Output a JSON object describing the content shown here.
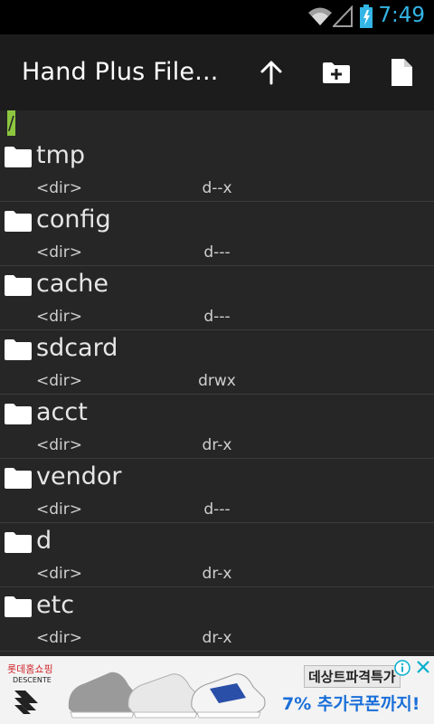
{
  "status_bar": {
    "time": "7:49",
    "icons": [
      "wifi-icon",
      "signal-icon",
      "battery-icon"
    ],
    "accent": "#33b5e5"
  },
  "action_bar": {
    "title": "Hand Plus File...",
    "actions": [
      "arrow-up-icon",
      "new-folder-icon",
      "new-file-icon"
    ]
  },
  "path_bar": {
    "path": "/",
    "highlight_color": "#8cc63f"
  },
  "files": [
    {
      "name": "tmp",
      "type": "<dir>",
      "perm": "d--x"
    },
    {
      "name": "config",
      "type": "<dir>",
      "perm": "d---"
    },
    {
      "name": "cache",
      "type": "<dir>",
      "perm": "d---"
    },
    {
      "name": "sdcard",
      "type": "<dir>",
      "perm": "drwx"
    },
    {
      "name": "acct",
      "type": "<dir>",
      "perm": "dr-x"
    },
    {
      "name": "vendor",
      "type": "<dir>",
      "perm": "d---"
    },
    {
      "name": "d",
      "type": "<dir>",
      "perm": "dr-x"
    },
    {
      "name": "etc",
      "type": "<dir>",
      "perm": "dr-x"
    }
  ],
  "ad": {
    "brand": "롯데홈쇼핑",
    "brand_sub": "DESCENTE",
    "line1": "데상트파격특가",
    "line2": "7% 추가쿠폰까지!"
  }
}
